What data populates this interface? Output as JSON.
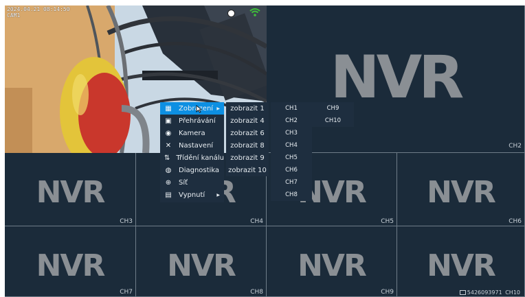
{
  "osd": {
    "timestamp": "2024.04.21 08:14:50",
    "channel": "CAM1"
  },
  "tiles": [
    {
      "logo": "NVR",
      "label": "CH2"
    },
    {
      "logo": "NVR",
      "label": "CH3"
    },
    {
      "logo": "NVR",
      "label": "CH4"
    },
    {
      "logo": "NVR",
      "label": "CH5"
    },
    {
      "logo": "NVR",
      "label": "CH6"
    },
    {
      "logo": "NVR",
      "label": "CH7"
    },
    {
      "logo": "NVR",
      "label": "CH8"
    },
    {
      "logo": "NVR",
      "label": "CH9"
    },
    {
      "logo": "NVR",
      "label": "CH10"
    }
  ],
  "status": {
    "serial": "5426093971"
  },
  "main_menu": [
    {
      "label": "Zobrazení",
      "icon": "grid-icon",
      "selected": true,
      "has_submenu": true
    },
    {
      "label": "Přehrávání",
      "icon": "playback-icon",
      "has_submenu": false
    },
    {
      "label": "Kamera",
      "icon": "camera-icon",
      "has_submenu": false
    },
    {
      "label": "Nastavení",
      "icon": "tools-icon",
      "has_submenu": false
    },
    {
      "label": "Třídění kanálu",
      "icon": "sort-icon",
      "has_submenu": false
    },
    {
      "label": "Diagnostika",
      "icon": "diagnostics-icon",
      "has_submenu": false
    },
    {
      "label": "Síť",
      "icon": "globe-icon",
      "has_submenu": false
    },
    {
      "label": "Vypnutí",
      "icon": "power-icon",
      "has_submenu": true
    }
  ],
  "layout_menu": [
    "zobrazit 1",
    "zobrazit 4",
    "zobrazit 6",
    "zobrazit 8",
    "zobrazit 9",
    "zobrazit 10"
  ],
  "channel_menu_col1": [
    "CH1",
    "CH2",
    "CH3",
    "CH4",
    "CH5",
    "CH6",
    "CH7",
    "CH8"
  ],
  "channel_menu_col2": [
    "CH9",
    "CH10"
  ],
  "colors": {
    "background": "#1b2b3a",
    "menu": "#1e2e3f",
    "selected": "#0d8fe2",
    "logo": "#8a8f94"
  }
}
